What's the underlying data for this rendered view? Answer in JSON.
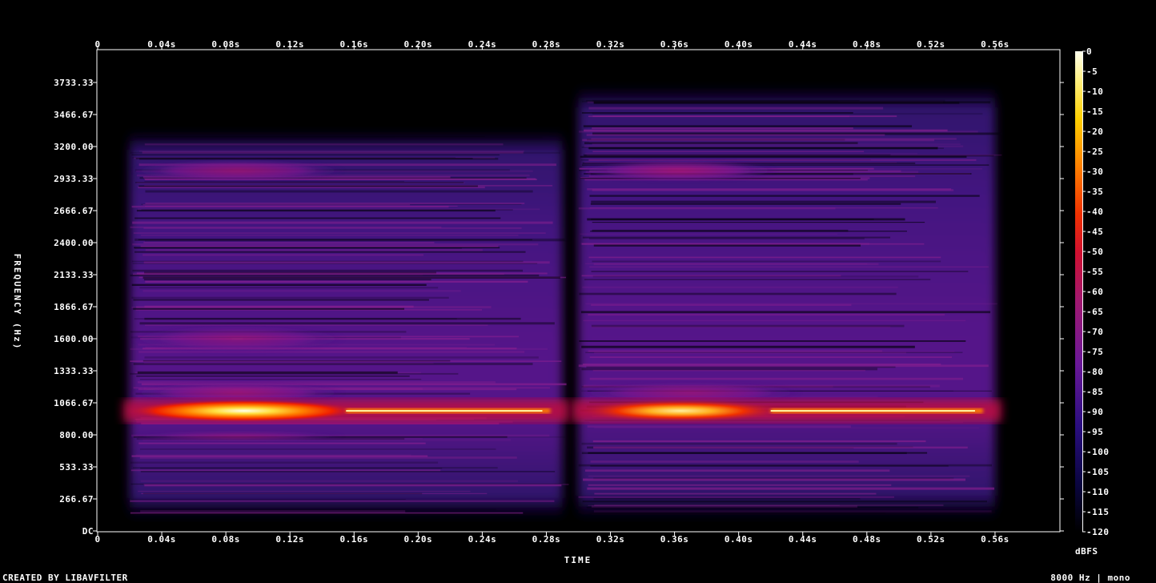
{
  "chart_data": {
    "type": "heatmap",
    "xlabel": "TIME",
    "ylabel": "FREQUENCY (Hz)",
    "x_ticks": [
      "0",
      "0.04s",
      "0.08s",
      "0.12s",
      "0.16s",
      "0.20s",
      "0.24s",
      "0.28s",
      "0.32s",
      "0.36s",
      "0.40s",
      "0.44s",
      "0.48s",
      "0.52s",
      "0.56s"
    ],
    "y_ticks": [
      "DC",
      "266.67",
      "533.33",
      "800.00",
      "1066.67",
      "1333.33",
      "1600.00",
      "1866.67",
      "2133.33",
      "2400.00",
      "2666.67",
      "2933.33",
      "3200.00",
      "3466.67",
      "3733.33"
    ],
    "xlim": [
      0,
      0.6
    ],
    "ylim": [
      0,
      4000
    ],
    "colorbar": {
      "label": "dBFS",
      "ticks": [
        "0",
        "-5",
        "-10",
        "-15",
        "-20",
        "-25",
        "-30",
        "-35",
        "-40",
        "-45",
        "-50",
        "-55",
        "-60",
        "-65",
        "-70",
        "-75",
        "-80",
        "-85",
        "-90",
        "-95",
        "-100",
        "-105",
        "-110",
        "-115",
        "-120"
      ],
      "range": [
        -120,
        0
      ]
    },
    "tones": [
      {
        "t_start": 0.02,
        "t_end": 0.29,
        "freq": 1000,
        "peak_dbfs": -10
      },
      {
        "t_start": 0.3,
        "t_end": 0.56,
        "freq": 1000,
        "peak_dbfs": -15
      }
    ],
    "footer_left": "CREATED BY LIBAVFILTER",
    "footer_right": "8000 Hz | mono",
    "colors": {
      "low": "#000000",
      "mid": "#7a1890",
      "high": "#ff2000",
      "peak": "#ffffe0"
    }
  }
}
